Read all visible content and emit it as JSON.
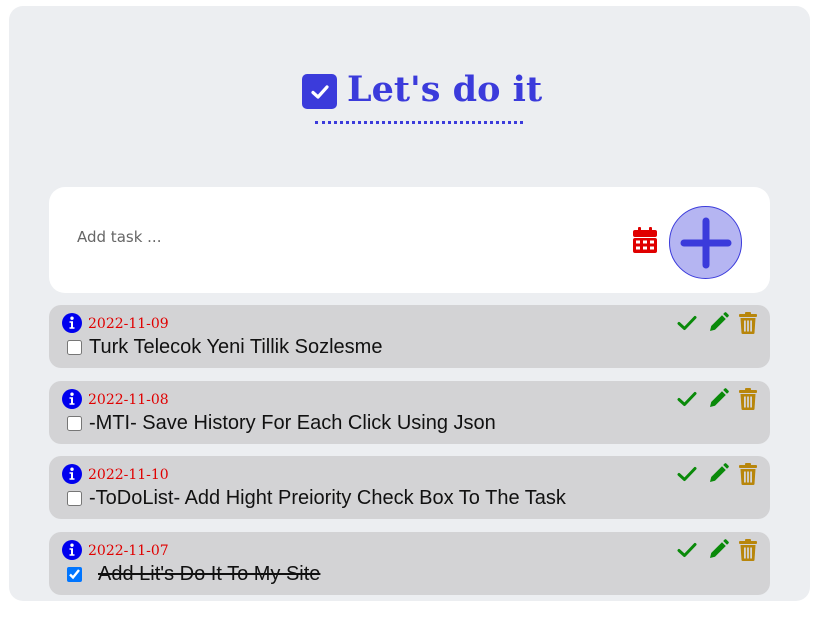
{
  "header": {
    "title": "Let's do it",
    "accent_color": "#3b3bdb"
  },
  "new_task": {
    "placeholder": "Add task ...",
    "value": "",
    "calendar_icon": "calendar-icon",
    "add_icon": "plus-icon"
  },
  "tasks": [
    {
      "date": "2022-11-09",
      "title": "Turk Telecok Yeni Tillik Sozlesme",
      "completed": false
    },
    {
      "date": "2022-11-08",
      "title": "-MTI- Save History For Each Click Using Json",
      "completed": false
    },
    {
      "date": "2022-11-10",
      "title": "-ToDoList- Add Hight Preiority Check Box To The Task",
      "completed": false
    },
    {
      "date": "2022-11-07",
      "title": "Add Lit's Do It To My Site",
      "completed": true
    }
  ],
  "colors": {
    "date": "#e00000",
    "complete_icon": "#0a8a0a",
    "edit_icon": "#0a8a0a",
    "delete_icon": "#b8860b",
    "info_icon": "#0000ee",
    "task_background": "#d3d3d5"
  }
}
